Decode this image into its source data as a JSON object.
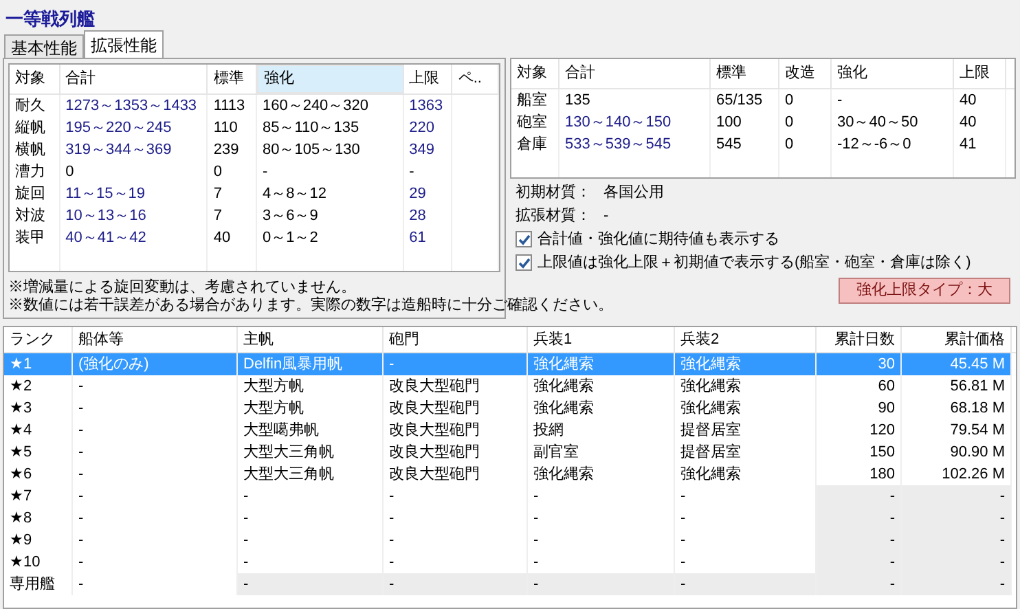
{
  "title": "一等戦列艦",
  "tabs": [
    {
      "label": "基本性能",
      "selected": false
    },
    {
      "label": "拡張性能",
      "selected": true
    }
  ],
  "main_table": {
    "columns": [
      {
        "label": "対象",
        "highlighted": false
      },
      {
        "label": "合計",
        "highlighted": false
      },
      {
        "label": "標準",
        "highlighted": false
      },
      {
        "label": "強化",
        "highlighted": true
      },
      {
        "label": "上限",
        "highlighted": false
      },
      {
        "label": "ペ..",
        "highlighted": false
      }
    ],
    "rows": [
      {
        "cells": [
          "耐久",
          "1273～1353～1433",
          "1113",
          "160～240～320",
          "1363"
        ],
        "tinted": [
          false,
          true,
          false,
          false,
          true
        ]
      },
      {
        "cells": [
          "縦帆",
          "195～220～245",
          "110",
          "85～110～135",
          "220"
        ],
        "tinted": [
          false,
          true,
          false,
          false,
          true
        ]
      },
      {
        "cells": [
          "横帆",
          "319～344～369",
          "239",
          "80～105～130",
          "349"
        ],
        "tinted": [
          false,
          true,
          false,
          false,
          true
        ]
      },
      {
        "cells": [
          "漕力",
          "0",
          "0",
          "-",
          "-"
        ],
        "tinted": [
          false,
          false,
          false,
          false,
          false
        ]
      },
      {
        "cells": [
          "旋回",
          "11～15～19",
          "7",
          "4～8～12",
          "29"
        ],
        "tinted": [
          false,
          true,
          false,
          false,
          true
        ]
      },
      {
        "cells": [
          "対波",
          "10～13～16",
          "7",
          "3～6～9",
          "28"
        ],
        "tinted": [
          false,
          true,
          false,
          false,
          true
        ]
      },
      {
        "cells": [
          "装甲",
          "40～41～42",
          "40",
          "0～1～2",
          "61"
        ],
        "tinted": [
          false,
          true,
          false,
          false,
          true
        ]
      }
    ]
  },
  "notes": [
    "※増減量による旋回変動は、考慮されていません。",
    "※数値には若干誤差がある場合があります。実際の数字は造船時に十分ご確認ください。"
  ],
  "room_table": {
    "columns": [
      {
        "label": "対象"
      },
      {
        "label": "合計"
      },
      {
        "label": "標準"
      },
      {
        "label": "改造"
      },
      {
        "label": "強化"
      },
      {
        "label": "上限"
      }
    ],
    "rows": [
      {
        "cells": [
          "船室",
          "135",
          "65/135",
          "0",
          "-",
          "40"
        ],
        "tinted": [
          false,
          false,
          false,
          false,
          false,
          false
        ]
      },
      {
        "cells": [
          "砲室",
          "130～140～150",
          "100",
          "0",
          "30～40～50",
          "40"
        ],
        "tinted": [
          false,
          true,
          false,
          false,
          false,
          false
        ]
      },
      {
        "cells": [
          "倉庫",
          "533～539～545",
          "545",
          "0",
          "-12～-6～0",
          "41"
        ],
        "tinted": [
          false,
          true,
          false,
          false,
          false,
          false
        ]
      }
    ]
  },
  "materials": [
    {
      "label": "初期材質：",
      "value": "各国公用"
    },
    {
      "label": "拡張材質：",
      "value": "-"
    }
  ],
  "options": [
    {
      "label": "合計値・強化値に期待値も表示する",
      "checked": true
    },
    {
      "label": "上限値は強化上限＋初期値で表示する(船室・砲室・倉庫は除く)",
      "checked": true
    }
  ],
  "limit_type": "強化上限タイプ：大",
  "upgrade_list": {
    "columns": [
      "ランク",
      "船体等",
      "主帆",
      "砲門",
      "兵装1",
      "兵装2",
      "累計日数",
      "累計価格"
    ],
    "rows": [
      {
        "selected": true,
        "cells": [
          "★1",
          "(強化のみ)",
          "Delfin風暴用帆",
          "-",
          "強化縄索",
          "強化縄索",
          "30",
          "45.45 M"
        ],
        "shaded": [
          false,
          false,
          false,
          false,
          false,
          false,
          false,
          false
        ]
      },
      {
        "selected": false,
        "cells": [
          "★2",
          "-",
          "大型方帆",
          "改良大型砲門",
          "強化縄索",
          "強化縄索",
          "60",
          "56.81 M"
        ],
        "shaded": [
          false,
          false,
          false,
          false,
          false,
          false,
          false,
          false
        ]
      },
      {
        "selected": false,
        "cells": [
          "★3",
          "-",
          "大型方帆",
          "改良大型砲門",
          "強化縄索",
          "強化縄索",
          "90",
          "68.18 M"
        ],
        "shaded": [
          false,
          false,
          false,
          false,
          false,
          false,
          false,
          false
        ]
      },
      {
        "selected": false,
        "cells": [
          "★4",
          "-",
          "大型噶弗帆",
          "改良大型砲門",
          "投網",
          "提督居室",
          "120",
          "79.54 M"
        ],
        "shaded": [
          false,
          false,
          false,
          false,
          false,
          false,
          false,
          false
        ]
      },
      {
        "selected": false,
        "cells": [
          "★5",
          "-",
          "大型大三角帆",
          "改良大型砲門",
          "副官室",
          "提督居室",
          "150",
          "90.90 M"
        ],
        "shaded": [
          false,
          false,
          false,
          false,
          false,
          false,
          false,
          false
        ]
      },
      {
        "selected": false,
        "cells": [
          "★6",
          "-",
          "大型大三角帆",
          "改良大型砲門",
          "強化縄索",
          "強化縄索",
          "180",
          "102.26 M"
        ],
        "shaded": [
          false,
          false,
          false,
          false,
          false,
          false,
          false,
          false
        ]
      },
      {
        "selected": false,
        "cells": [
          "★7",
          "-",
          "-",
          "-",
          "-",
          "-",
          "-",
          "-"
        ],
        "shaded": [
          false,
          false,
          false,
          false,
          false,
          false,
          true,
          true
        ]
      },
      {
        "selected": false,
        "cells": [
          "★8",
          "-",
          "-",
          "-",
          "-",
          "-",
          "-",
          "-"
        ],
        "shaded": [
          false,
          false,
          false,
          false,
          false,
          false,
          true,
          true
        ]
      },
      {
        "selected": false,
        "cells": [
          "★9",
          "-",
          "-",
          "-",
          "-",
          "-",
          "-",
          "-"
        ],
        "shaded": [
          false,
          false,
          false,
          false,
          false,
          false,
          true,
          true
        ]
      },
      {
        "selected": false,
        "cells": [
          "★10",
          "-",
          "-",
          "-",
          "-",
          "-",
          "-",
          "-"
        ],
        "shaded": [
          false,
          false,
          false,
          false,
          false,
          false,
          true,
          true
        ]
      },
      {
        "selected": false,
        "cells": [
          "専用艦",
          "-",
          "-",
          "-",
          "-",
          "-",
          "-",
          "-"
        ],
        "shaded": [
          false,
          false,
          true,
          true,
          true,
          true,
          true,
          true
        ]
      }
    ]
  }
}
